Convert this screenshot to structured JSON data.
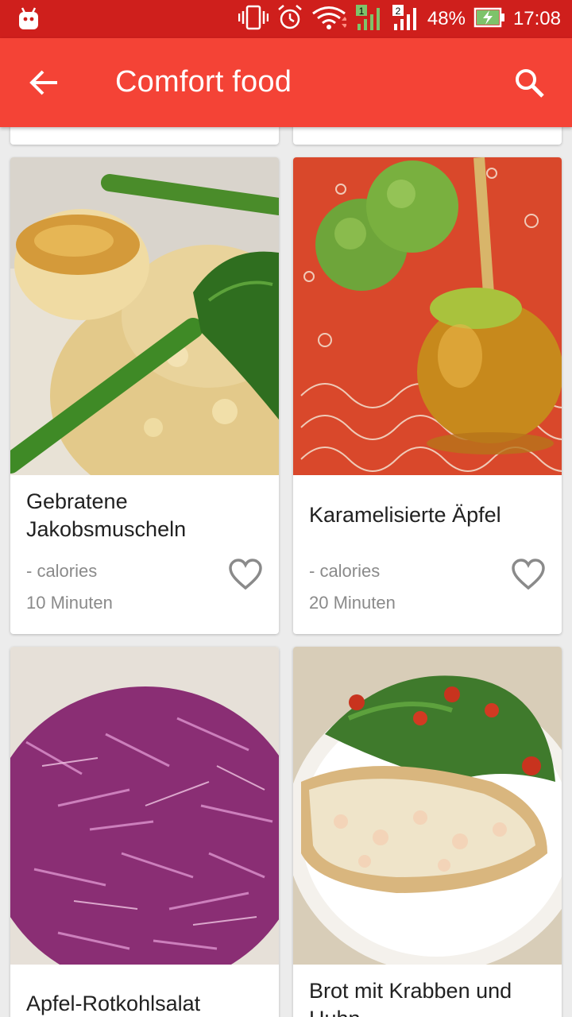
{
  "status_bar": {
    "battery": "48%",
    "time": "17:08",
    "icons": [
      "android-icon",
      "vibrate-icon",
      "alarm-icon",
      "wifi-icon",
      "signal-sim1-icon",
      "signal-sim2-icon",
      "battery-charging-icon"
    ]
  },
  "app_bar": {
    "title": "Comfort food",
    "back_icon": "arrow-back-icon",
    "search_icon": "search-icon"
  },
  "recipes": [
    {
      "name": "Gebratene Jakobsmuscheln",
      "calories": "- calories",
      "time": "10 Minuten"
    },
    {
      "name": "Karamelisierte Äpfel",
      "calories": "- calories",
      "time": "20 Minuten"
    },
    {
      "name": "Apfel-Rotkohlsalat",
      "calories": "",
      "time": ""
    },
    {
      "name": "Brot mit Krabben und Huhn",
      "calories": "",
      "time": ""
    }
  ],
  "colors": {
    "status_bar": "#cf1f1c",
    "app_bar": "#f44336",
    "background": "#ececec"
  }
}
